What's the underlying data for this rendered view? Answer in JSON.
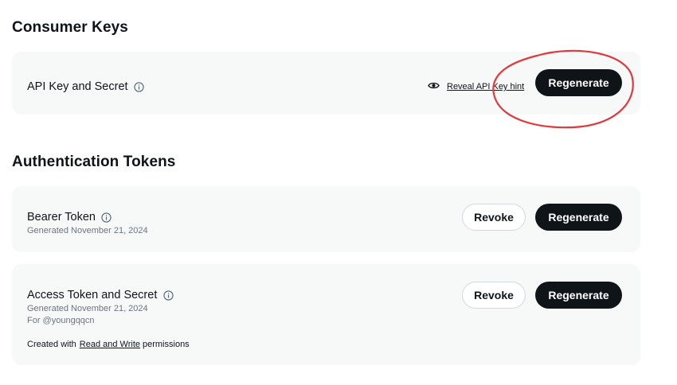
{
  "consumer_keys": {
    "section_title": "Consumer Keys",
    "api_key": {
      "title": "API Key and Secret",
      "reveal_link": "Reveal API Key hint",
      "regenerate_label": "Regenerate"
    }
  },
  "auth_tokens": {
    "section_title": "Authentication Tokens",
    "bearer": {
      "title": "Bearer Token",
      "generated": "Generated November 21, 2024",
      "revoke_label": "Revoke",
      "regenerate_label": "Regenerate"
    },
    "access": {
      "title": "Access Token and Secret",
      "generated": "Generated November 21, 2024",
      "for_user": "For @youngqqcn",
      "permissions_prefix": "Created with",
      "permissions_link": "Read and Write",
      "permissions_suffix": "permissions",
      "revoke_label": "Revoke",
      "regenerate_label": "Regenerate"
    }
  },
  "icons": {
    "info": "info-icon",
    "eye": "eye-icon"
  },
  "colors": {
    "primary_button": "#0f1419",
    "card_background": "#f7f9f9",
    "annotation": "#e0393e"
  }
}
